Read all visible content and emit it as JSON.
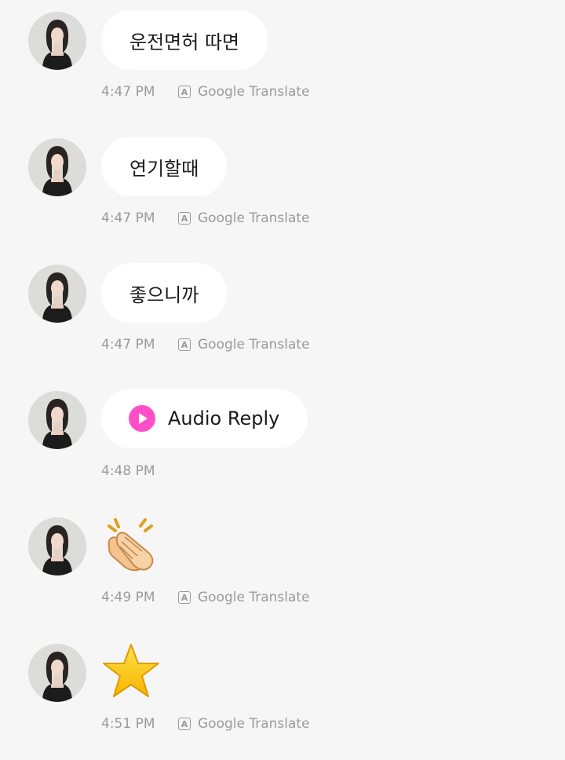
{
  "messages": [
    {
      "type": "text",
      "text": "운전면허 따면",
      "time": "4:47 PM",
      "translate_label": "Google Translate"
    },
    {
      "type": "text",
      "text": "연기할때",
      "time": "4:47 PM",
      "translate_label": "Google Translate"
    },
    {
      "type": "text",
      "text": "좋으니까",
      "time": "4:47 PM",
      "translate_label": "Google Translate"
    },
    {
      "type": "audio",
      "text": "Audio Reply",
      "time": "4:48 PM",
      "icon": "play-icon",
      "accent": "#ff4fc8"
    },
    {
      "type": "emoji",
      "emoji_name": "clapping-hands-emoji",
      "time": "4:49 PM",
      "translate_label": "Google Translate"
    },
    {
      "type": "emoji",
      "emoji_name": "star-emoji",
      "time": "4:51 PM",
      "translate_label": "Google Translate"
    }
  ],
  "translate_icon": {
    "name": "translate-icon",
    "glyph": "A"
  },
  "colors": {
    "background": "#f6f6f6",
    "bubble": "#ffffff",
    "meta_text": "#9a9a9a",
    "audio_accent": "#ff4fc8"
  }
}
